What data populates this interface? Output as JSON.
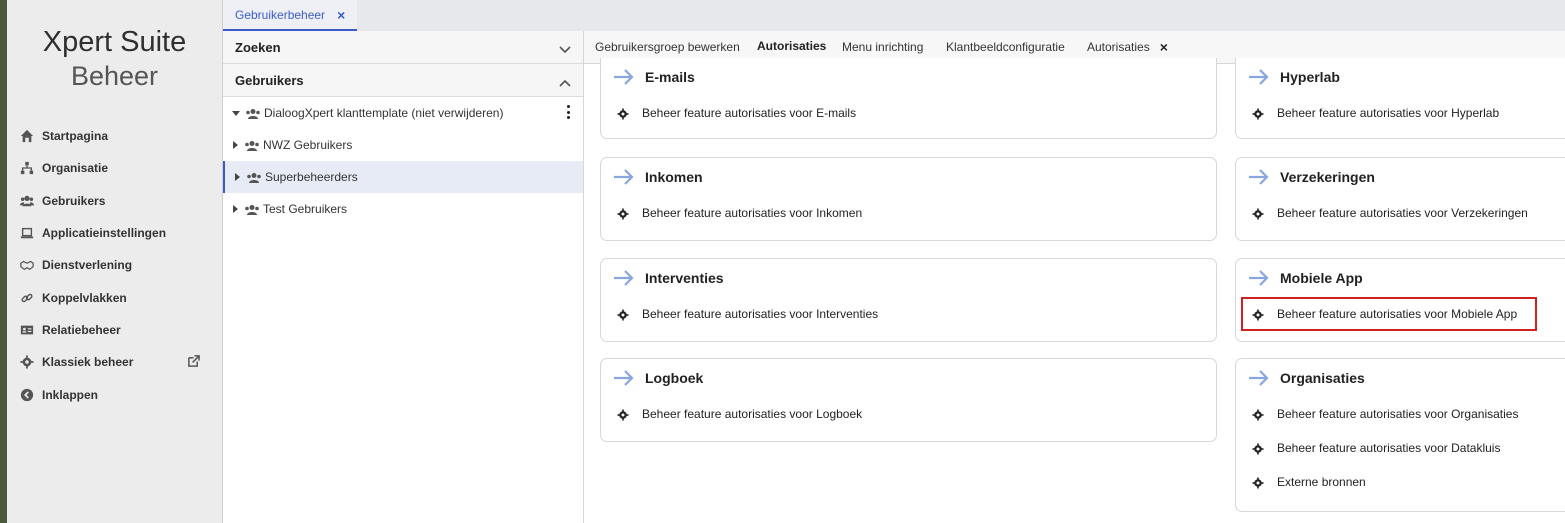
{
  "brand": {
    "line1": "Xpert Suite",
    "line2": "Beheer"
  },
  "sidebar": {
    "items": [
      {
        "label": "Startpagina",
        "icon": "home-icon"
      },
      {
        "label": "Organisatie",
        "icon": "sitemap-icon"
      },
      {
        "label": "Gebruikers",
        "icon": "users-icon"
      },
      {
        "label": "Applicatieinstellingen",
        "icon": "laptop-icon"
      },
      {
        "label": "Dienstverlening",
        "icon": "handshake-icon"
      },
      {
        "label": "Koppelvlakken",
        "icon": "link-icon"
      },
      {
        "label": "Relatiebeheer",
        "icon": "id-card-icon"
      },
      {
        "label": "Klassiek beheer",
        "icon": "gear-icon",
        "external": true
      },
      {
        "label": "Inklappen",
        "icon": "chevron-left-circle-icon"
      }
    ]
  },
  "top_tab": {
    "label": "Gebruikerbeheer",
    "close": "×"
  },
  "panel": {
    "search_title": "Zoeken",
    "users_title": "Gebruikers",
    "groups": [
      {
        "label": "DialoogXpert klanttemplate (niet verwijderen)",
        "expanded": true
      },
      {
        "label": "NWZ Gebruikers",
        "expanded": false
      },
      {
        "label": "Superbeheerders",
        "expanded": false,
        "selected": true
      },
      {
        "label": "Test Gebruikers",
        "expanded": false
      }
    ]
  },
  "subtabs": {
    "tabs": [
      {
        "label": "Gebruikersgroep bewerken"
      },
      {
        "label": "Autorisaties",
        "active": true
      },
      {
        "label": "Menu inrichting"
      },
      {
        "label": "Klantbeeldconfiguratie"
      },
      {
        "label": "Autorisaties",
        "closable": true
      }
    ],
    "close": "×"
  },
  "cards_left": [
    {
      "title": "E-mails",
      "items": [
        "Beheer feature autorisaties voor E-mails"
      ]
    },
    {
      "title": "Inkomen",
      "items": [
        "Beheer feature autorisaties voor Inkomen"
      ]
    },
    {
      "title": "Interventies",
      "items": [
        "Beheer feature autorisaties voor Interventies"
      ]
    },
    {
      "title": "Logboek",
      "items": [
        "Beheer feature autorisaties voor Logboek"
      ]
    }
  ],
  "cards_right": [
    {
      "title": "Hyperlab",
      "items": [
        "Beheer feature autorisaties voor Hyperlab"
      ]
    },
    {
      "title": "Verzekeringen",
      "items": [
        "Beheer feature autorisaties voor Verzekeringen"
      ]
    },
    {
      "title": "Mobiele App",
      "items": [
        "Beheer feature autorisaties voor Mobiele App"
      ],
      "highlighted": true
    },
    {
      "title": "Organisaties",
      "items": [
        "Beheer feature autorisaties voor Organisaties",
        "Beheer feature autorisaties voor Datakluis",
        "Externe bronnen"
      ]
    }
  ],
  "colors": {
    "accent": "#3b5bcc",
    "arrow": "#8aa6e0",
    "highlight": "#d21f1f",
    "sidebar_bg": "#ececec"
  }
}
